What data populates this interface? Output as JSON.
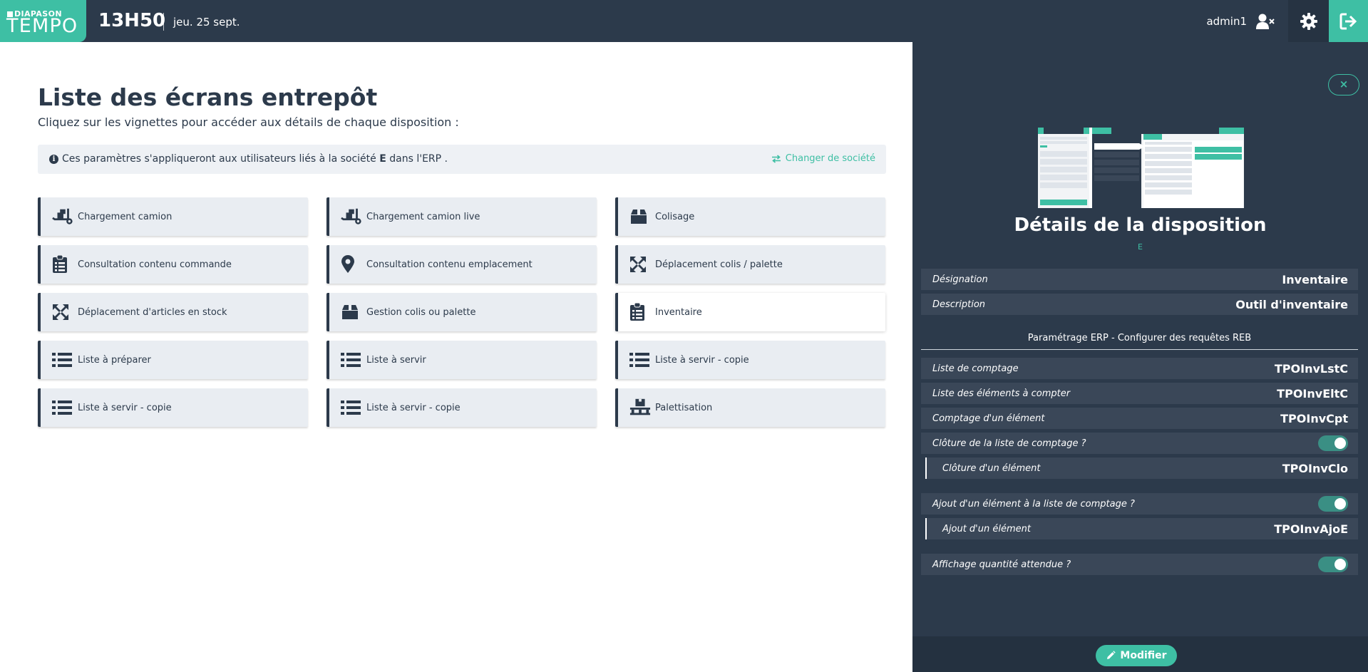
{
  "app": {
    "logo_top": "DIAPASON",
    "logo_main": "TEMPO",
    "time": "13H50",
    "date": "jeu. 25 sept.",
    "username": "admin1"
  },
  "main": {
    "title": "Liste des écrans entrepôt",
    "subtitle": "Cliquez sur les vignettes pour accéder aux détails de chaque disposition :",
    "info_prefix": "Ces paramètres s'appliqueront aux utilisateurs liés à la société ",
    "info_company": "E",
    "info_suffix": " dans l'ERP .",
    "change_company": "Changer de société",
    "tiles": [
      {
        "label": "Chargement camion",
        "icon": "truck-loading-icon"
      },
      {
        "label": "Chargement camion live",
        "icon": "truck-loading-icon"
      },
      {
        "label": "Colisage",
        "icon": "box-icon"
      },
      {
        "label": "Consultation contenu commande",
        "icon": "clipboard-list-icon"
      },
      {
        "label": "Consultation contenu emplacement",
        "icon": "map-marker-icon"
      },
      {
        "label": "Déplacement colis / palette",
        "icon": "expand-arrows-icon"
      },
      {
        "label": "Déplacement d'articles en stock",
        "icon": "expand-arrows-icon"
      },
      {
        "label": "Gestion colis ou palette",
        "icon": "box-icon"
      },
      {
        "label": "Inventaire",
        "icon": "clipboard-list-icon"
      },
      {
        "label": "Liste à préparer",
        "icon": "list-icon"
      },
      {
        "label": "Liste à servir",
        "icon": "list-icon"
      },
      {
        "label": "Liste à servir - copie",
        "icon": "list-icon"
      },
      {
        "label": "Liste à servir - copie",
        "icon": "list-icon"
      },
      {
        "label": "Liste à servir - copie",
        "icon": "list-icon"
      },
      {
        "label": "Palettisation",
        "icon": "pallet-icon"
      }
    ],
    "selected_tile": "Inventaire"
  },
  "panel": {
    "close": "×",
    "title": "Détails de la disposition",
    "company": "E",
    "designation_label": "Désignation",
    "designation_value": "Inventaire",
    "description_label": "Description",
    "description_value": "Outil d'inventaire",
    "erp_title": "Paramétrage ERP - Configurer des requêtes REB",
    "liste_comptage_label": "Liste de comptage",
    "liste_comptage_value": "TPOInvLstC",
    "elements_label": "Liste des éléments à compter",
    "elements_value": "TPOInvEltC",
    "comptage_label": "Comptage d'un élément",
    "comptage_value": "TPOInvCpt",
    "cloture_liste_label": "Clôture de la liste de comptage ?",
    "cloture_liste_on": true,
    "cloture_element_label": "Clôture d'un élément",
    "cloture_element_value": "TPOInvClo",
    "ajout_liste_label": "Ajout d'un élément à la liste de comptage ?",
    "ajout_liste_on": true,
    "ajout_element_label": "Ajout d'un élément",
    "ajout_element_value": "TPOInvAjoE",
    "affichage_label": "Affichage quantité attendue ?",
    "affichage_on": true,
    "modify_button": "Modifier"
  },
  "colors": {
    "accent": "#3ebfa4",
    "dark": "#2c3a4b",
    "tile_bg": "#e9edf2"
  }
}
